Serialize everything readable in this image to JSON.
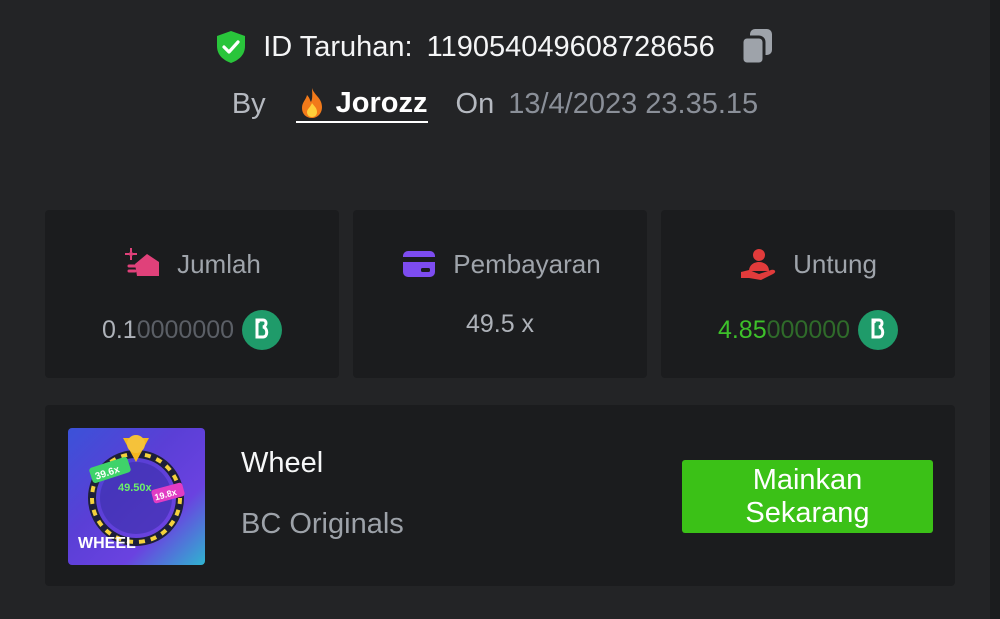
{
  "bet": {
    "id_label": "ID Taruhan:",
    "id_value": "119054049608728656",
    "by_label": "By",
    "username": "Jorozz",
    "on_label": "On",
    "date": "13/4/2023 23.35.15"
  },
  "stats": [
    {
      "label": "Jumlah",
      "value_main": "0.1",
      "value_dim": "0000000",
      "icon": "bet-amount-icon",
      "coin": "bc-coin-icon"
    },
    {
      "label": "Pembayaran",
      "value_main": "49.5 x",
      "value_dim": "",
      "icon": "wallet-card-icon"
    },
    {
      "label": "Untung",
      "value_main": "4.85",
      "value_dim": "000000",
      "icon": "profit-hand-icon",
      "coin": "bc-coin-icon"
    }
  ],
  "game": {
    "name": "Wheel",
    "provider": "BC Originals",
    "thumb_title": "WHEEL",
    "thumb_mult_1": "39.6x",
    "thumb_mult_2": "49.50x",
    "thumb_mult_3": "19.8x",
    "play_label": "Mainkan Sekarang"
  },
  "colors": {
    "background": "#232426",
    "card": "#1b1c1e",
    "accent_green": "#3bc117",
    "profit_green": "#3dc12a",
    "coin_green": "#1f9b6a"
  }
}
